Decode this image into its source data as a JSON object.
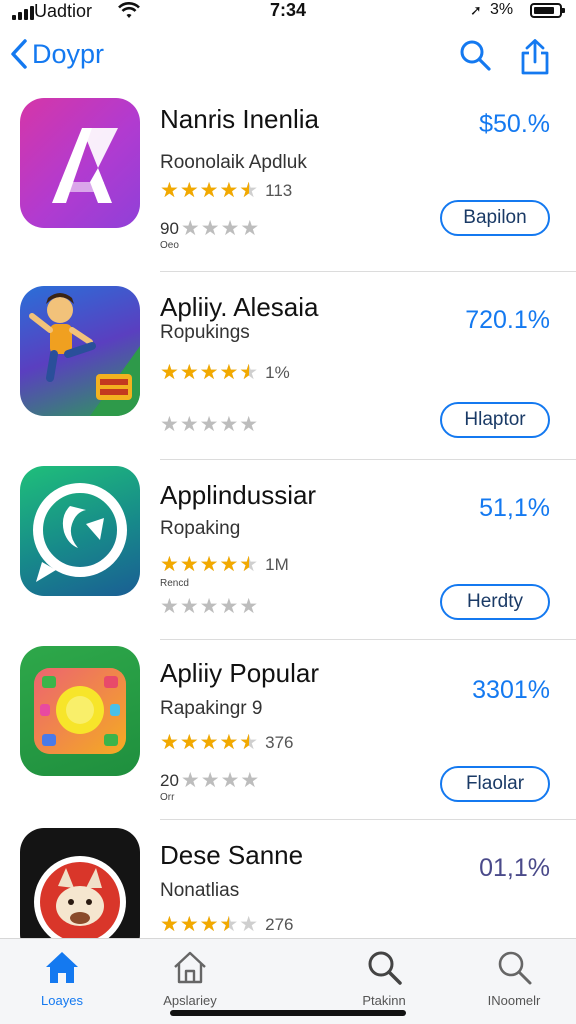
{
  "status_bar": {
    "carrier": "Uadtior",
    "time": "7:34",
    "battery": "3%"
  },
  "nav": {
    "back_label": "Doypr",
    "icons": [
      "search-icon",
      "share-icon"
    ],
    "accent_color": "#1479f0"
  },
  "apps": [
    {
      "name": "Nanris Inenlia",
      "subtitle": "Roonolaik Apdluk",
      "stars": 4.5,
      "rating_count": "113",
      "second_number": "90",
      "tiny_label": "Oeo",
      "price": "$50.%",
      "button": "Bapilon",
      "icon": "letter-a-icon"
    },
    {
      "name": "Apliiy. Alesaia",
      "subtitle": "Ropukings",
      "stars": 4.5,
      "rating_count": "1%",
      "second_number": "",
      "tiny_label": "",
      "price": "720.1%",
      "button": "Hlaptor",
      "icon": "cartoon-character-icon"
    },
    {
      "name": "Applindussiar",
      "subtitle": "Ropaking",
      "stars": 4.5,
      "rating_count": "1M",
      "second_number": "",
      "tiny_label": "Rencd",
      "price": "51,1%",
      "button": "Herdty",
      "icon": "chat-bubble-icon"
    },
    {
      "name": "Apliiy Popular",
      "subtitle": "Rapakingr 9",
      "stars": 4.5,
      "rating_count": "376",
      "second_number": "20",
      "tiny_label": "Orr",
      "price": "3301%",
      "button": "Flaolar",
      "icon": "game-controller-icon"
    },
    {
      "name": "Dese Sanne",
      "subtitle": "Nonatlias",
      "stars": 3.5,
      "rating_count": "276",
      "second_number": "",
      "tiny_label": "",
      "price": "01,1%",
      "button": "",
      "icon": "fox-icon"
    }
  ],
  "tabs": [
    {
      "label": "Loayes",
      "icon": "home-icon",
      "active": true
    },
    {
      "label": "Apslariey",
      "icon": "house-outline-icon",
      "active": false
    },
    {
      "label": "Ptakinn",
      "icon": "search-icon",
      "active": false
    },
    {
      "label": "INoomelr",
      "icon": "search-icon",
      "active": false
    }
  ]
}
